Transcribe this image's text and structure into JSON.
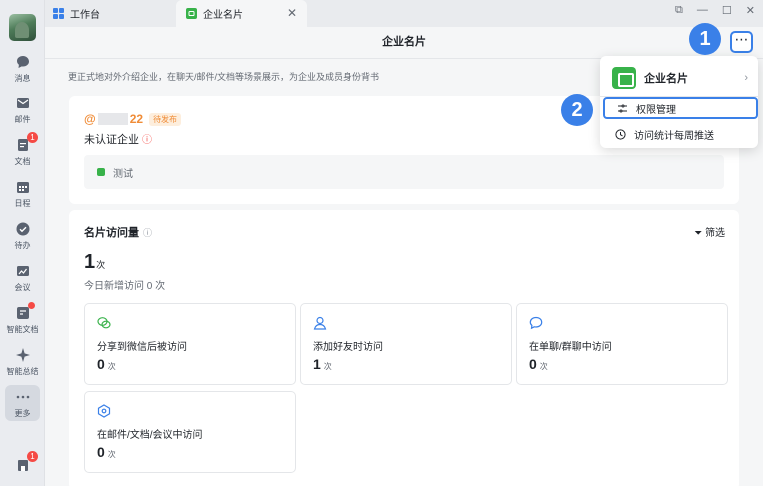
{
  "sidebar": {
    "items": [
      {
        "label": "消息"
      },
      {
        "label": "邮件"
      },
      {
        "label": "文档",
        "badge": "1"
      },
      {
        "label": "日程"
      },
      {
        "label": "待办"
      },
      {
        "label": "会议"
      },
      {
        "label": "智能文档"
      },
      {
        "label": "智能总结"
      },
      {
        "label": "更多"
      }
    ],
    "bottom_badge": "1"
  },
  "tabs": [
    {
      "label": "工作台"
    },
    {
      "label": "企业名片"
    }
  ],
  "page_title": "企业名片",
  "intro": "更正式地对外介绍企业，在聊天/邮件/文档等场景展示，为企业及成员身份背书",
  "card": {
    "handle_prefix": "@",
    "handle_suffix": "22",
    "pending_label": "待发布",
    "uncertified": "未认证企业",
    "test_label": "测试"
  },
  "stats": {
    "title": "名片访问量",
    "filter_label": "筛选",
    "total": "1",
    "total_unit": "次",
    "today": "今日新增访问 0 次",
    "items": [
      {
        "label": "分享到微信后被访问",
        "value": "0",
        "unit": "次"
      },
      {
        "label": "添加好友时访问",
        "value": "1",
        "unit": "次"
      },
      {
        "label": "在单聊/群聊中访问",
        "value": "0",
        "unit": "次"
      },
      {
        "label": "在邮件/文档/会议中访问",
        "value": "0",
        "unit": "次"
      }
    ]
  },
  "dropdown": {
    "head": "企业名片",
    "item1": "权限管理",
    "item2": "访问统计每周推送"
  },
  "steps": {
    "one": "1",
    "two": "2"
  },
  "colors": {
    "accent": "#3a80e8",
    "orange": "#f08c37",
    "green": "#38b24a",
    "red": "#f54a45"
  }
}
